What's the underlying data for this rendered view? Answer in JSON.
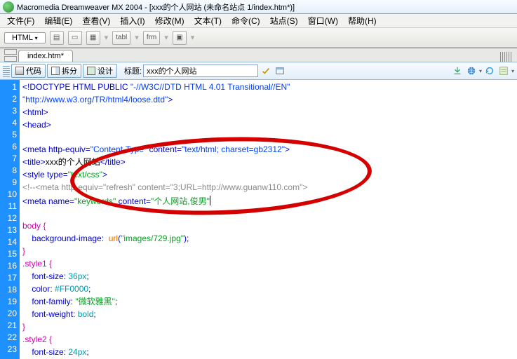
{
  "title_bar": "Macromedia Dreamweaver MX 2004 - [xxx的个人网站 (未命名站点 1/index.htm*)]",
  "menu": {
    "file": "文件(F)",
    "edit": "编辑(E)",
    "view": "查看(V)",
    "insert": "插入(I)",
    "modify": "修改(M)",
    "text": "文本(T)",
    "commands": "命令(C)",
    "site": "站点(S)",
    "window": "窗口(W)",
    "help": "帮助(H)"
  },
  "toolstrip": {
    "mode": "HTML",
    "tabl": "tabl",
    "frm": "frm"
  },
  "tab": {
    "name": "index.htm*"
  },
  "viewbar": {
    "code": "代码",
    "split": "拆分",
    "design": "设计",
    "title_label": "标题:",
    "title_value": "xxx的个人网站"
  },
  "lines": [
    "1",
    "2",
    "3",
    "4",
    "5",
    "6",
    "7",
    "8",
    "9",
    "10",
    "11",
    "12",
    "13",
    "14",
    "15",
    "16",
    "17",
    "18",
    "19",
    "20",
    "21",
    "22",
    "23"
  ],
  "code": {
    "l1a": "<!DOCTYPE HTML PUBLIC ",
    "l1b": "\"-//W3C//DTD HTML 4.01 Transitional//EN\"",
    "l2": "\"http://www.w3.org/TR/html4/loose.dtd\"",
    "l2end": ">",
    "l3": "<html>",
    "l4": "<head>",
    "l6a": "<meta http-equiv=",
    "l6b": "\"Content-Type\"",
    "l6c": " content=",
    "l6d": "\"text/html; charset=gb2312\"",
    "l6e": ">",
    "l7a": "<title>",
    "l7b": "xxx的个人网站",
    "l7c": "</title>",
    "l8a": "<style type=",
    "l8b": "\"text/css\"",
    "l8c": ">",
    "l9": "<!--<meta http-equiv=\"refresh\" content=\"3;URL=http://www.guanw110.com\">",
    "l10a": "<meta name=",
    "l10b": "\"keywords\"",
    "l10c": " content=",
    "l10d": "\"个人网站,俊男\"",
    "l12": "body {",
    "l13a": "    background-image:  ",
    "l13b": "url",
    "l13c": "(",
    "l13d": "\"images/729.jpg\"",
    "l13e": ");",
    "l14": "}",
    "l15": ".style1 {",
    "l16a": "    font-size: ",
    "l16b": "36px",
    "l16c": ";",
    "l17a": "    color: ",
    "l17b": "#FF0000",
    "l17c": ";",
    "l18a": "    font-family: ",
    "l18b": "\"微软雅黑\"",
    "l18c": ";",
    "l19a": "    font-weight: ",
    "l19b": "bold",
    "l19c": ";",
    "l20": "}",
    "l21": ".style2 {",
    "l22a": "    font-size: ",
    "l22b": "24px",
    "l22c": ";"
  }
}
